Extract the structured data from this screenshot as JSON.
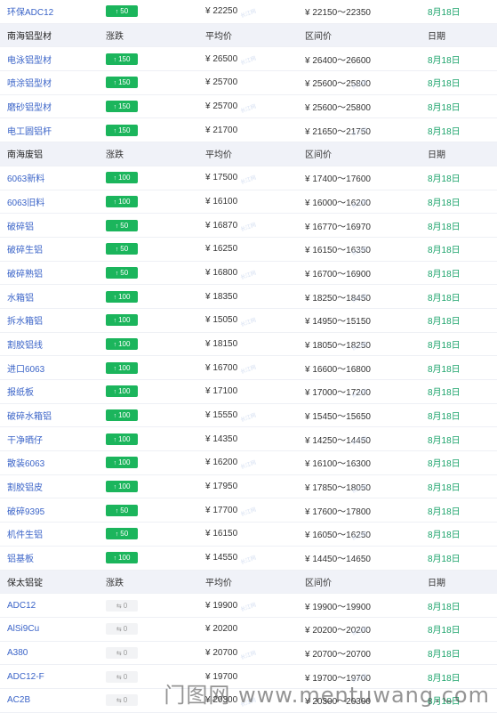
{
  "sections": [
    {
      "has_header": false,
      "rows": [
        {
          "name": "环保ADC12",
          "change": "50",
          "kind": "up",
          "price": "¥ 22250",
          "range": "¥ 22150～22350",
          "date": "8月18日"
        }
      ]
    },
    {
      "has_header": true,
      "header": {
        "name": "南海铝型材",
        "change": "涨跌",
        "price": "平均价",
        "range": "区间价",
        "date": "日期"
      },
      "rows": [
        {
          "name": "电泳铝型材",
          "change": "150",
          "kind": "up",
          "price": "¥ 26500",
          "range": "¥ 26400～26600",
          "date": "8月18日"
        },
        {
          "name": "喷涂铝型材",
          "change": "150",
          "kind": "up",
          "price": "¥ 25700",
          "range": "¥ 25600～25800",
          "date": "8月18日"
        },
        {
          "name": "磨砂铝型材",
          "change": "150",
          "kind": "up",
          "price": "¥ 25700",
          "range": "¥ 25600～25800",
          "date": "8月18日"
        },
        {
          "name": "电工圆铝杆",
          "change": "150",
          "kind": "up",
          "price": "¥ 21700",
          "range": "¥ 21650～21750",
          "date": "8月18日"
        }
      ]
    },
    {
      "has_header": true,
      "header": {
        "name": "南海废铝",
        "change": "涨跌",
        "price": "平均价",
        "range": "区间价",
        "date": "日期"
      },
      "rows": [
        {
          "name": "6063新料",
          "change": "100",
          "kind": "up",
          "price": "¥ 17500",
          "range": "¥ 17400～17600",
          "date": "8月18日"
        },
        {
          "name": "6063旧料",
          "change": "100",
          "kind": "up",
          "price": "¥ 16100",
          "range": "¥ 16000～16200",
          "date": "8月18日"
        },
        {
          "name": "破碎铝",
          "change": "50",
          "kind": "up",
          "price": "¥ 16870",
          "range": "¥ 16770～16970",
          "date": "8月18日"
        },
        {
          "name": "破碎生铝",
          "change": "50",
          "kind": "up",
          "price": "¥ 16250",
          "range": "¥ 16150～16350",
          "date": "8月18日"
        },
        {
          "name": "破碎熟铝",
          "change": "50",
          "kind": "up",
          "price": "¥ 16800",
          "range": "¥ 16700～16900",
          "date": "8月18日"
        },
        {
          "name": "水箱铝",
          "change": "100",
          "kind": "up",
          "price": "¥ 18350",
          "range": "¥ 18250～18450",
          "date": "8月18日"
        },
        {
          "name": "拆水箱铝",
          "change": "100",
          "kind": "up",
          "price": "¥ 15050",
          "range": "¥ 14950～15150",
          "date": "8月18日"
        },
        {
          "name": "割胶铝线",
          "change": "100",
          "kind": "up",
          "price": "¥ 18150",
          "range": "¥ 18050～18250",
          "date": "8月18日"
        },
        {
          "name": "进口6063",
          "change": "100",
          "kind": "up",
          "price": "¥ 16700",
          "range": "¥ 16600～16800",
          "date": "8月18日"
        },
        {
          "name": "报纸板",
          "change": "100",
          "kind": "up",
          "price": "¥ 17100",
          "range": "¥ 17000～17200",
          "date": "8月18日"
        },
        {
          "name": "破碎水箱铝",
          "change": "100",
          "kind": "up",
          "price": "¥ 15550",
          "range": "¥ 15450～15650",
          "date": "8月18日"
        },
        {
          "name": "干净晒仔",
          "change": "100",
          "kind": "up",
          "price": "¥ 14350",
          "range": "¥ 14250～14450",
          "date": "8月18日"
        },
        {
          "name": "散装6063",
          "change": "100",
          "kind": "up",
          "price": "¥ 16200",
          "range": "¥ 16100～16300",
          "date": "8月18日"
        },
        {
          "name": "割胶铝皮",
          "change": "100",
          "kind": "up",
          "price": "¥ 17950",
          "range": "¥ 17850～18050",
          "date": "8月18日"
        },
        {
          "name": "破碎9395",
          "change": "50",
          "kind": "up",
          "price": "¥ 17700",
          "range": "¥ 17600～17800",
          "date": "8月18日"
        },
        {
          "name": "机件生铝",
          "change": "50",
          "kind": "up",
          "price": "¥ 16150",
          "range": "¥ 16050～16250",
          "date": "8月18日"
        },
        {
          "name": "铝基板",
          "change": "100",
          "kind": "up",
          "price": "¥ 14550",
          "range": "¥ 14450～14650",
          "date": "8月18日"
        }
      ]
    },
    {
      "has_header": true,
      "header": {
        "name": "保太铝锭",
        "change": "涨跌",
        "price": "平均价",
        "range": "区间价",
        "date": "日期"
      },
      "rows": [
        {
          "name": "ADC12",
          "change": "0",
          "kind": "zero",
          "price": "¥ 19900",
          "range": "¥ 19900～19900",
          "date": "8月18日"
        },
        {
          "name": "AlSi9Cu",
          "change": "0",
          "kind": "zero",
          "price": "¥ 20200",
          "range": "¥ 20200～20200",
          "date": "8月18日"
        },
        {
          "name": "A380",
          "change": "0",
          "kind": "zero",
          "price": "¥ 20700",
          "range": "¥ 20700～20700",
          "date": "8月18日"
        },
        {
          "name": "ADC12-F",
          "change": "0",
          "kind": "zero",
          "price": "¥ 19700",
          "range": "¥ 19700～19700",
          "date": "8月18日"
        },
        {
          "name": "AC2B",
          "change": "0",
          "kind": "zero",
          "price": "¥ 20300",
          "range": "¥ 20300～20300",
          "date": "8月18日"
        }
      ]
    }
  ],
  "watermark": "门图网 www.mentuwang.com",
  "row_watermark": "长江网",
  "colors": {
    "up": "#1bb55c",
    "date": "#1aa36a",
    "link": "#3b64c8",
    "header_bg": "#f0f2f8"
  }
}
